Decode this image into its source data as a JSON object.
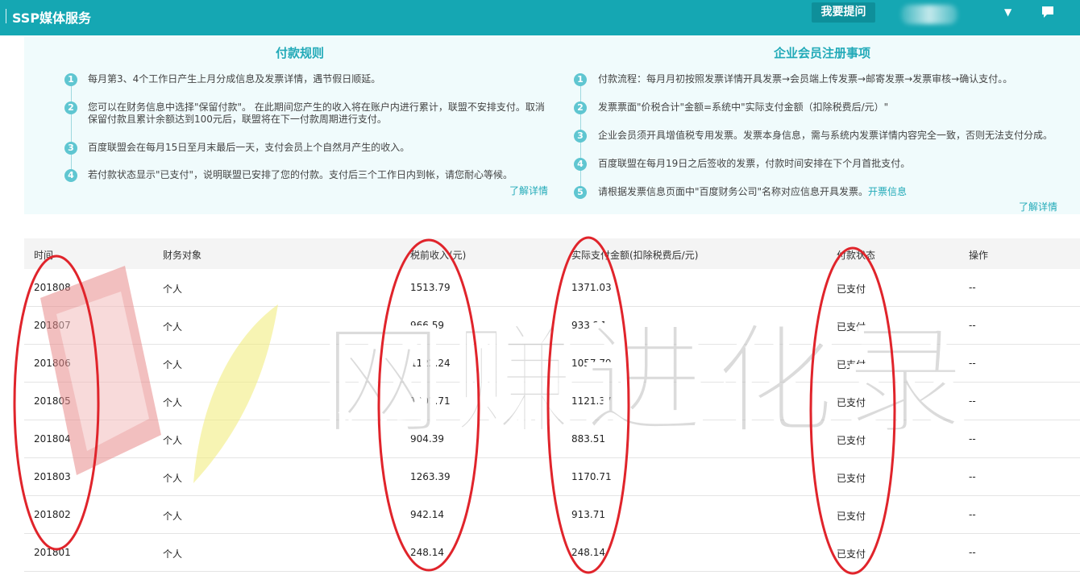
{
  "header": {
    "title": "SSP媒体服务",
    "ask_button": "我要提问"
  },
  "payment_rules": {
    "title": "付款规则",
    "items": [
      {
        "num": "1",
        "lines": [
          "每月第3、4个工作日产生上月分成信息及发票详情，遇节假日顺延。"
        ]
      },
      {
        "num": "2",
        "lines": [
          "您可以在财务信息中选择\"保留付款\"。 在此期间您产生的收入将在账户内进行累计，联盟不安排支付。取消",
          "保留付款且累计余额达到100元后，联盟将在下一付款周期进行支付。"
        ]
      },
      {
        "num": "3",
        "lines": [
          "百度联盟会在每月15日至月末最后一天，支付会员上个自然月产生的收入。"
        ]
      },
      {
        "num": "4",
        "lines": [
          "若付款状态显示\"已支付\"，说明联盟已安排了您的付款。支付后三个工作日内到帐，请您耐心等候。"
        ]
      }
    ],
    "detail_link": "了解详情"
  },
  "enterprise_rules": {
    "title": "企业会员注册事项",
    "items": [
      {
        "num": "1",
        "text": "付款流程：每月月初按照发票详情开具发票→会员端上传发票→邮寄发票→发票审核→确认支付。。"
      },
      {
        "num": "2",
        "text": "发票票面\"价税合计\"金额=系统中\"实际支付金额（扣除税费后/元）\""
      },
      {
        "num": "3",
        "text": "企业会员须开具增值税专用发票。发票本身信息，需与系统内发票详情内容完全一致，否则无法支付分成。"
      },
      {
        "num": "4",
        "text": "百度联盟在每月19日之后签收的发票，付款时间安排在下个月首批支付。"
      },
      {
        "num": "5",
        "text": "请根据发票信息页面中\"百度财务公司\"名称对应信息开具发票。",
        "link": "开票信息"
      }
    ],
    "detail_link": "了解详情"
  },
  "table": {
    "columns": [
      "时间",
      "财务对象",
      "税前收入(元)",
      "实际支付金额(扣除税费后/元)",
      "付款状态",
      "操作"
    ],
    "rows": [
      [
        "201808",
        "个人",
        "1513.79",
        "1371.03",
        "已支付",
        "--"
      ],
      [
        "201807",
        "个人",
        "966.59",
        "933.27",
        "已支付",
        "--"
      ],
      [
        "201806",
        "个人",
        "1122.24",
        "1057.79",
        "已支付",
        "--"
      ],
      [
        "201805",
        "个人",
        "1201.71",
        "1121.37",
        "已支付",
        "--"
      ],
      [
        "201804",
        "个人",
        "904.39",
        "883.51",
        "已支付",
        "--"
      ],
      [
        "201803",
        "个人",
        "1263.39",
        "1170.71",
        "已支付",
        "--"
      ],
      [
        "201802",
        "个人",
        "942.14",
        "913.71",
        "已支付",
        "--"
      ],
      [
        "201801",
        "个人",
        "248.14",
        "248.14",
        "已支付",
        "--"
      ]
    ]
  },
  "watermark": {
    "text": "网赚进化录"
  },
  "colors": {
    "header_bg": "#15a7b3",
    "accent": "#22aab8",
    "annotation": "#e0242b"
  },
  "icons": {
    "message": "chat-bubble-icon",
    "dropdown": "caret-down-icon"
  }
}
